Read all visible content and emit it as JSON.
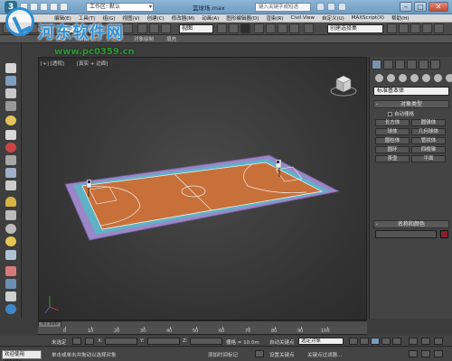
{
  "titlebar": {
    "workspace": "工作区: 默认",
    "doc_title": "篮球场.max",
    "search_placeholder": "键入关键字或短语"
  },
  "menubar": {
    "items": [
      "编辑(E)",
      "工具(T)",
      "组(G)",
      "视图(V)",
      "创建(C)",
      "修改器(M)",
      "动画(A)",
      "图形编辑器(D)",
      "渲染(R)",
      "Civil View",
      "自定义(U)",
      "MAXScript(X)",
      "帮助(H)"
    ]
  },
  "toolbar": {
    "filter": "全部",
    "view": "视图",
    "selection_set": "创建选择集"
  },
  "ribbon": {
    "items": [
      "建模",
      "自由形式",
      "选择",
      "对象绘制",
      "填充"
    ]
  },
  "watermark": {
    "name": "河东软件网",
    "url": "www.pc0359.cn"
  },
  "viewport": {
    "label_left": "[+] [透视]",
    "label_right": "[真实 + 边面]"
  },
  "command_panel": {
    "dropdown": "标准基本体",
    "object_type_title": "对象类型",
    "autogrid": "自动栅格",
    "buttons": [
      "长方体",
      "圆锥体",
      "球体",
      "几何球体",
      "圆柱体",
      "管状体",
      "圆环",
      "四棱锥",
      "茶壶",
      "平面"
    ],
    "name_color_title": "名称和颜色"
  },
  "timeline": {
    "frame": "0 / 100",
    "ticks": [
      "0",
      "10",
      "20",
      "30",
      "40",
      "50",
      "60",
      "70",
      "80",
      "90",
      "100"
    ]
  },
  "status": {
    "welcome": "欢迎使用 MAXSc",
    "none_selected": "未选定",
    "x_label": "X:",
    "y_label": "Y:",
    "z_label": "Z:",
    "grid": "栅格 = 10.0m",
    "auto_key": "自动关键点",
    "selected_object": "选定对象",
    "hint": "单击或单击并拖动以选择对象",
    "add_time_tag": "添加时间标记",
    "set_key": "设置关键点",
    "key_filters": "关键点过滤器..."
  },
  "colors": {
    "court": "#c8703a",
    "border_teal": "#5fb1c6",
    "border_purple": "#9b86c7",
    "accent": "#7994ad"
  }
}
